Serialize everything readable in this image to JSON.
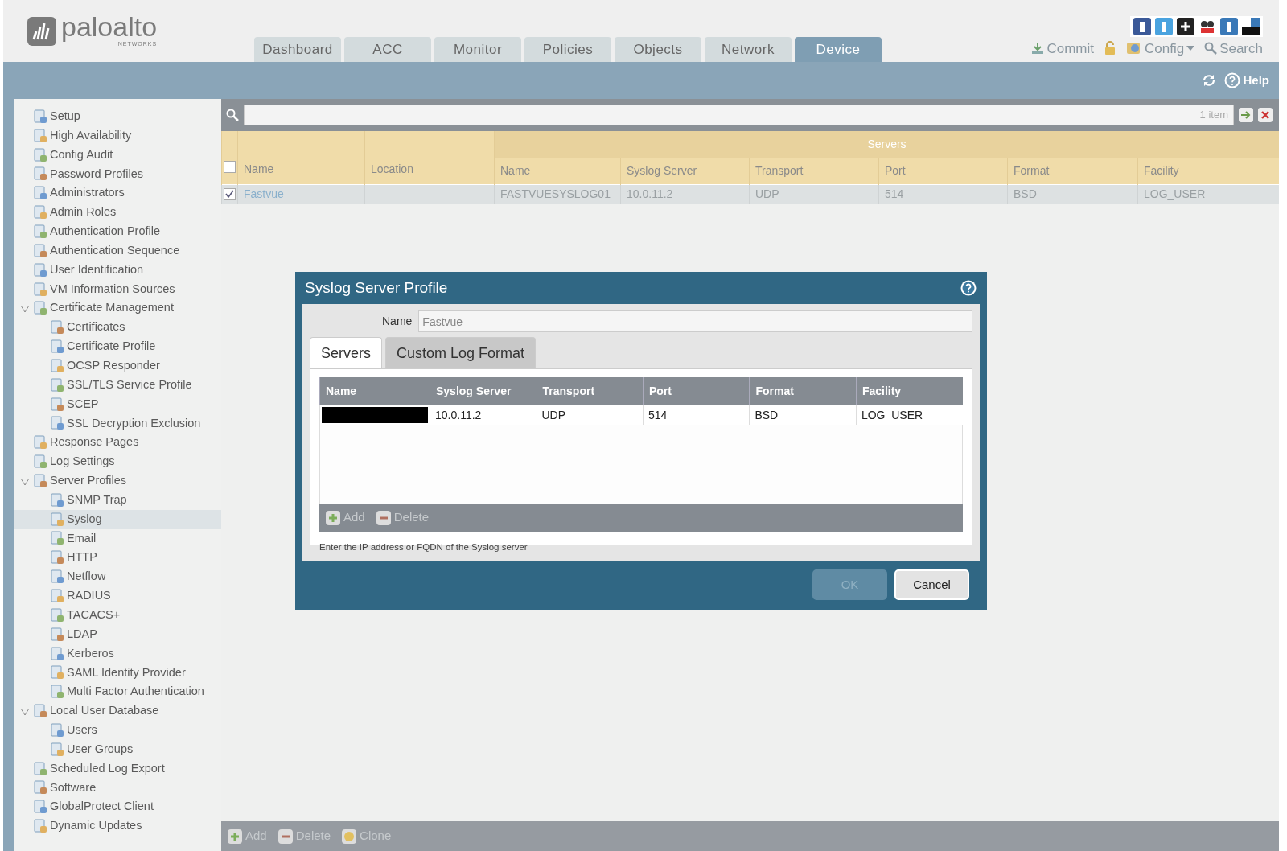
{
  "header": {
    "logo": {
      "brand": "paloalto",
      "tagline": "NETWORKS"
    },
    "tabs": [
      {
        "label": "Dashboard",
        "selected": false
      },
      {
        "label": "ACC",
        "selected": false
      },
      {
        "label": "Monitor",
        "selected": false
      },
      {
        "label": "Policies",
        "selected": false
      },
      {
        "label": "Objects",
        "selected": false
      },
      {
        "label": "Network",
        "selected": false
      },
      {
        "label": "Device",
        "selected": true
      }
    ],
    "actions": [
      {
        "kind": "commit",
        "label": "Commit"
      },
      {
        "kind": "lock"
      },
      {
        "kind": "config",
        "label": "Config",
        "dropdown": true
      },
      {
        "kind": "search",
        "label": "Search"
      }
    ],
    "help_label": "Help"
  },
  "sidebar": {
    "items": [
      {
        "label": "Setup"
      },
      {
        "label": "High Availability"
      },
      {
        "label": "Config Audit"
      },
      {
        "label": "Password Profiles"
      },
      {
        "label": "Administrators"
      },
      {
        "label": "Admin Roles"
      },
      {
        "label": "Authentication Profile"
      },
      {
        "label": "Authentication Sequence"
      },
      {
        "label": "User Identification"
      },
      {
        "label": "VM Information Sources"
      },
      {
        "label": "Certificate Management",
        "expanded": true,
        "children": [
          {
            "label": "Certificates"
          },
          {
            "label": "Certificate Profile"
          },
          {
            "label": "OCSP Responder"
          },
          {
            "label": "SSL/TLS Service Profile"
          },
          {
            "label": "SCEP"
          },
          {
            "label": "SSL Decryption Exclusion"
          }
        ]
      },
      {
        "label": "Response Pages"
      },
      {
        "label": "Log Settings"
      },
      {
        "label": "Server Profiles",
        "expanded": true,
        "children": [
          {
            "label": "SNMP Trap",
            "selected": false
          },
          {
            "label": "Syslog",
            "selected": true
          },
          {
            "label": "Email",
            "selected": false
          },
          {
            "label": "HTTP",
            "selected": false
          },
          {
            "label": "Netflow",
            "selected": false
          },
          {
            "label": "RADIUS",
            "selected": false
          },
          {
            "label": "TACACS+",
            "selected": false
          },
          {
            "label": "LDAP",
            "selected": false
          },
          {
            "label": "Kerberos",
            "selected": false
          },
          {
            "label": "SAML Identity Provider",
            "selected": false
          },
          {
            "label": "Multi Factor Authentication",
            "selected": false
          }
        ]
      },
      {
        "label": "Local User Database",
        "expanded": true,
        "children": [
          {
            "label": "Users"
          },
          {
            "label": "User Groups"
          }
        ]
      },
      {
        "label": "Scheduled Log Export"
      },
      {
        "label": "Software"
      },
      {
        "label": "GlobalProtect Client"
      },
      {
        "label": "Dynamic Updates"
      }
    ]
  },
  "grid": {
    "count": "1 item",
    "select_all_checked": false,
    "group_header": "Servers",
    "columns": [
      "Name",
      "Location",
      "Name",
      "Syslog Server",
      "Transport",
      "Port",
      "Format",
      "Facility"
    ],
    "rows": [
      {
        "selected": true,
        "checked": true,
        "cells": [
          "Fastvue",
          "",
          "FASTVUESYSLOG01",
          "10.0.11.2",
          "UDP",
          "514",
          "BSD",
          "LOG_USER"
        ]
      }
    ],
    "toolbar": [
      {
        "kind": "add",
        "label": "Add",
        "disabled": true
      },
      {
        "kind": "delete",
        "label": "Delete",
        "disabled": true
      },
      {
        "kind": "clone",
        "label": "Clone",
        "disabled": true
      }
    ]
  },
  "dialog": {
    "title": "Syslog Server Profile",
    "name_label": "Name",
    "name_value": "Fastvue",
    "tabs": [
      {
        "label": "Servers",
        "selected": true
      },
      {
        "label": "Custom Log Format",
        "selected": false
      }
    ],
    "columns": [
      "Name",
      "Syslog Server",
      "Transport",
      "Port",
      "Format",
      "Facility"
    ],
    "rows": [
      {
        "name_redacted": true,
        "cells": [
          "",
          "10.0.11.2",
          "UDP",
          "514",
          "BSD",
          "LOG_USER"
        ]
      }
    ],
    "toolbar": [
      {
        "kind": "add",
        "label": "Add",
        "disabled": true
      },
      {
        "kind": "delete",
        "label": "Delete",
        "disabled": true
      }
    ],
    "hint": "Enter the IP address or FQDN of the Syslog server",
    "buttons": [
      {
        "label": "OK",
        "disabled": true
      },
      {
        "label": "Cancel",
        "disabled": false
      }
    ]
  }
}
